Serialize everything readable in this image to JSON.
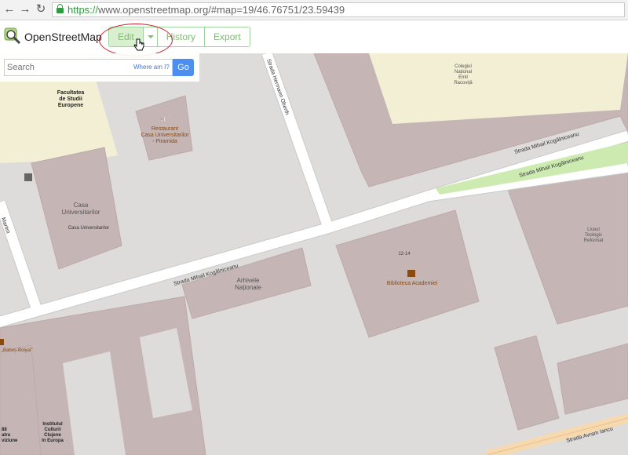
{
  "browser": {
    "url_scheme": "https://",
    "url_rest": "www.openstreetmap.org/#map=19/46.76751/23.59439"
  },
  "header": {
    "brand": "OpenStreetMap",
    "edit_label": "Edit",
    "history_label": "History",
    "export_label": "Export"
  },
  "search": {
    "placeholder": "Search",
    "where_am_i": "Where am I?",
    "go_label": "Go"
  },
  "map_labels": {
    "facultatea": [
      "Facultatea",
      "de Studii",
      "Europene"
    ],
    "restaurant": [
      "Restaurant",
      "Casa Universitarilor",
      "- Piramida"
    ],
    "casa_universitarilor_big": [
      "Casa",
      "Universitarilor"
    ],
    "casa_universitarilor_small": "Casa Universitarilor",
    "colegiul": [
      "Colegiul",
      "Național",
      "Emil",
      "Racoviță"
    ],
    "strada_hermann": "Strada Hermann Oberth",
    "strada_mihail_1": "Strada Mihail Kogălniceanu",
    "strada_mihail_2": "Strada Mihail Kogălniceanu",
    "strada_mihail_3": "Strada Mihail Kogălniceanu",
    "martirii": "Martirii",
    "arhivele": [
      "Arhivele",
      "Naționale"
    ],
    "address_12_14": "12-14",
    "biblioteca": "Biblioteca Academiei",
    "liceul": [
      "Liceul",
      "Teologic",
      "Reformat"
    ],
    "babes": "„Babeș-Bolyai\"",
    "institutul": [
      "Institutul",
      "Culturii",
      "Clujene",
      "în Europa"
    ],
    "partial_88": [
      "88",
      "atru",
      "viziune"
    ],
    "strada_avram": "Strada Avram Iancu"
  }
}
